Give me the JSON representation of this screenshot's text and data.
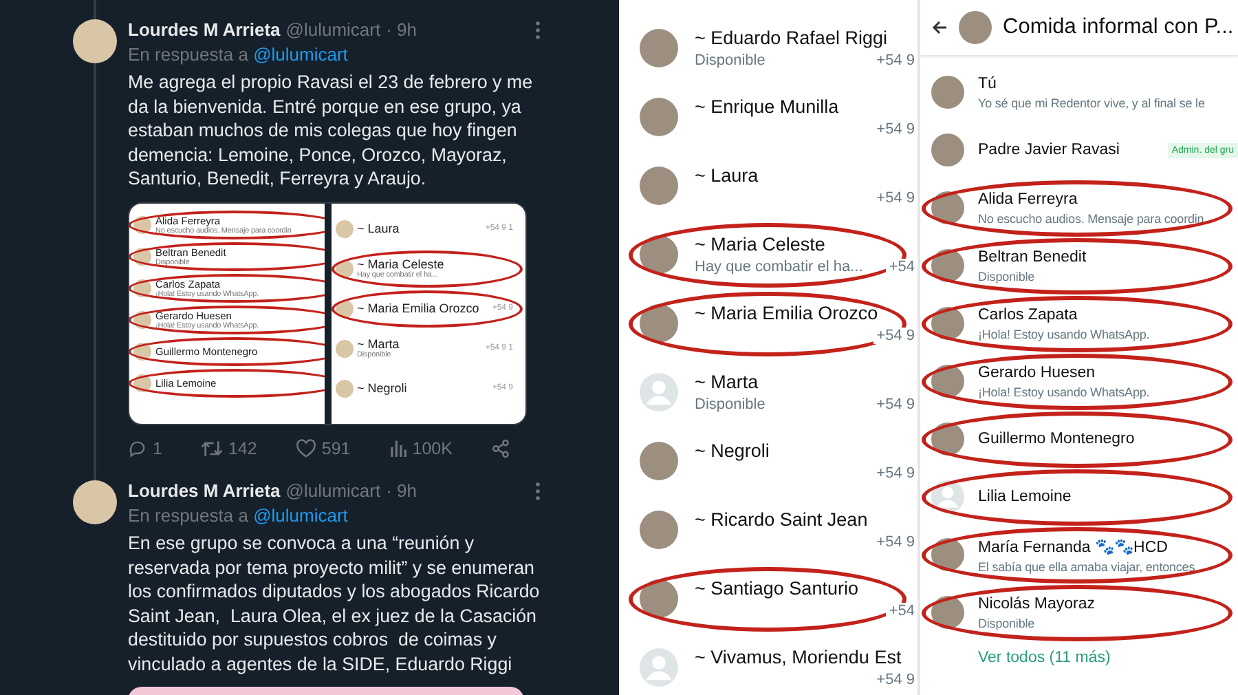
{
  "tweets": [
    {
      "author": "Lourdes M Arrieta",
      "handle": "@lulumicart",
      "time": "· 9h",
      "reply_prefix": "En respuesta a",
      "reply_to": "@lulumicart",
      "text": "Me agrega el propio Ravasi el 23 de febrero y me da la bienvenida. Entré porque en ese grupo, ya estaban muchos de mis colegas que hoy fingen demencia: Lemoine, Ponce, Orozco, Mayoraz, Santurio, Benedit, Ferreyra y Araujo.",
      "media": {
        "kind": "screenshots",
        "left_items": [
          {
            "name": "Alida Ferreyra",
            "status": "No escucho audios. Mensaje para coordin",
            "circled": true
          },
          {
            "name": "Beltran Benedit",
            "status": "Disponible",
            "circled": true
          },
          {
            "name": "Carlos Zapata",
            "status": "¡Hola! Estoy usando WhatsApp.",
            "circled": true
          },
          {
            "name": "Gerardo Huesen",
            "status": "¡Hola! Estoy usando WhatsApp.",
            "circled": true
          },
          {
            "name": "Guillermo Montenegro",
            "circled": true
          },
          {
            "name": "Lilia Lemoine",
            "circled": true
          }
        ],
        "right_items": [
          {
            "name": "~ Laura",
            "phone": "+54 9 1",
            "circled": false
          },
          {
            "name": "~ Maria Celeste",
            "status": "Hay que combatir el ha...",
            "circled": true
          },
          {
            "name": "~ Maria Emilia Orozco",
            "phone": "+54 9",
            "circled": true
          },
          {
            "name": "~ Marta",
            "status": "Disponible",
            "phone": "+54 9 1",
            "circled": false
          },
          {
            "name": "~ Negroli",
            "phone": "+54 9",
            "circled": false
          }
        ]
      },
      "actions": {
        "replies": "1",
        "retweets": "142",
        "likes": "591",
        "views": "100K"
      }
    },
    {
      "author": "Lourdes M Arrieta",
      "handle": "@lulumicart",
      "time": "· 9h",
      "reply_prefix": "En respuesta a",
      "reply_to": "@lulumicart",
      "text": "En ese grupo se convoca a una “reunión y reservada por tema proyecto milit” y se enumeran los confirmados diputados y los abogados Ricardo Saint Jean,  Laura Olea, el ex juez de la Casación destituido por supuestos cobros  de coimas y vinculado a agentes de la SIDE, Eduardo Riggi",
      "media": {
        "kind": "card"
      }
    }
  ],
  "contact_list": {
    "items": [
      {
        "name": "~ Eduardo Rafael Riggi",
        "status": "Disponible",
        "phone": "+54 9",
        "kind": "photo",
        "circled": false
      },
      {
        "name": "~ Enrique Munilla",
        "phone": "+54 9",
        "kind": "photo",
        "circled": false
      },
      {
        "name": "~ Laura",
        "phone": "+54 9",
        "kind": "photo",
        "circled": false
      },
      {
        "name": "~ Maria Celeste",
        "status": "Hay que combatir el ha...",
        "phone": "+54",
        "kind": "photo",
        "circled": true
      },
      {
        "name": "~ Maria Emilia Orozco",
        "phone": "+54 9",
        "kind": "photo",
        "circled": true
      },
      {
        "name": "~ Marta",
        "status": "Disponible",
        "phone": "+54 9",
        "kind": "default",
        "circled": false
      },
      {
        "name": "~ Negroli",
        "phone": "+54 9",
        "kind": "photo",
        "circled": false
      },
      {
        "name": "~ Ricardo Saint Jean",
        "phone": "+54 9",
        "kind": "photo",
        "circled": false
      },
      {
        "name": "~ Santiago Santurio",
        "phone": "+54",
        "kind": "photo",
        "circled": true
      },
      {
        "name": "~ Vivamus, Moriendu Est",
        "phone": "+54 9",
        "kind": "default",
        "circled": false
      }
    ]
  },
  "group_info": {
    "title": "Comida informal con P...",
    "members": [
      {
        "name": "Tú",
        "status": "Yo sé que mi Redentor vive, y al final se le",
        "kind": "photo",
        "circled": false
      },
      {
        "name": "Padre Javier Ravasi",
        "badge": "Admin. del gru",
        "kind": "photo",
        "circled": false
      },
      {
        "name": "Alida Ferreyra",
        "status": "No escucho audios. Mensaje para coordin",
        "kind": "photo",
        "circled": true
      },
      {
        "name": "Beltran Benedit",
        "status": "Disponible",
        "kind": "photo",
        "circled": true
      },
      {
        "name": "Carlos Zapata",
        "status": "¡Hola! Estoy usando WhatsApp.",
        "kind": "photo",
        "circled": true
      },
      {
        "name": "Gerardo Huesen",
        "status": "¡Hola! Estoy usando WhatsApp.",
        "kind": "photo",
        "circled": true
      },
      {
        "name": "Guillermo Montenegro",
        "kind": "photo",
        "circled": true
      },
      {
        "name": "Lilia Lemoine",
        "kind": "default",
        "circled": true
      },
      {
        "name": "María Fernanda 🐾🐾HCD",
        "status": "El sabía que ella amaba viajar, entonces",
        "kind": "photo",
        "circled": true
      },
      {
        "name": "Nicolás Mayoraz",
        "status": "Disponible",
        "kind": "photo",
        "circled": true
      }
    ],
    "more_link": "Ver todos (11 más)"
  }
}
